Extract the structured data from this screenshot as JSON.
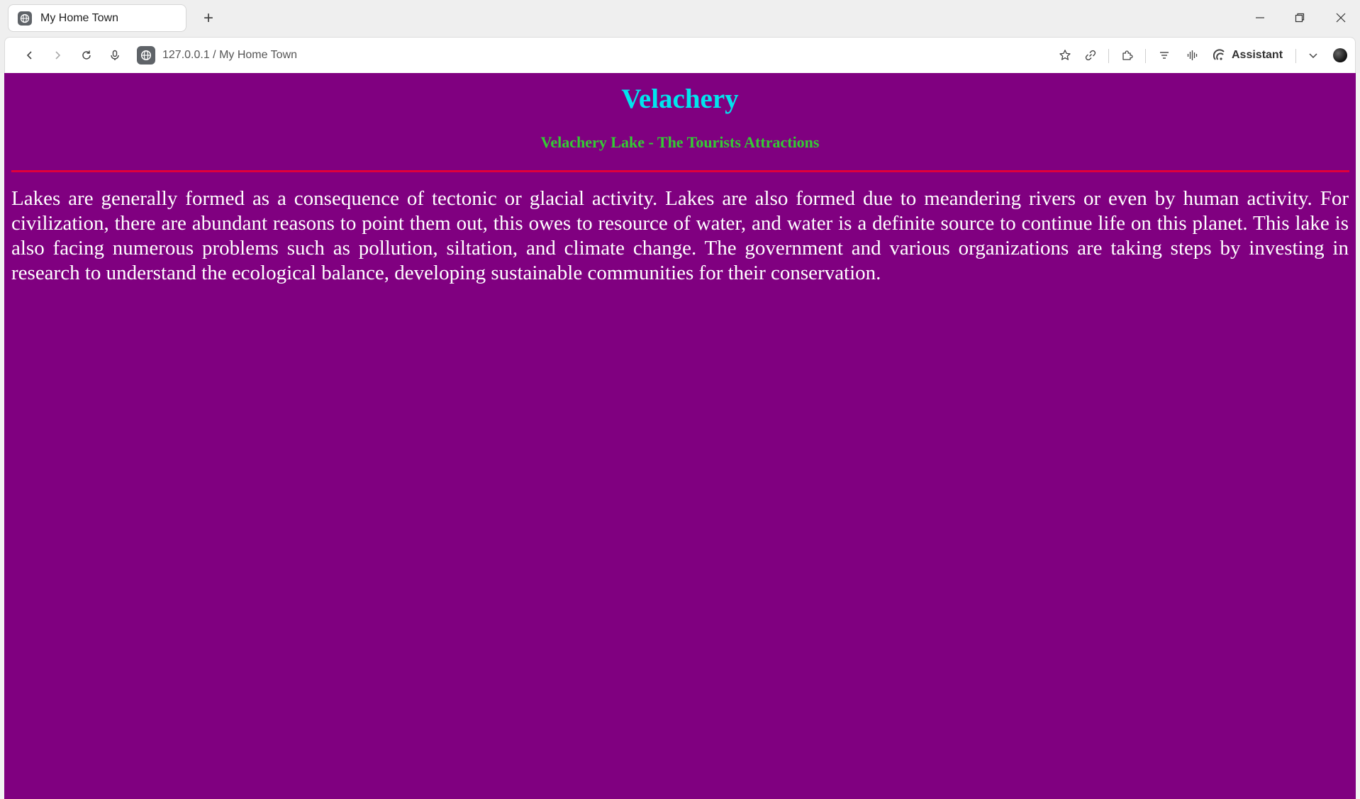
{
  "browser": {
    "tab_title": "My Home Town",
    "new_tab_symbol": "+",
    "url": "127.0.0.1 / My Home Town",
    "assistant_label": "Assistant",
    "icons": {
      "favicon": "globe-icon",
      "back": "back-arrow-icon",
      "forward": "forward-arrow-icon",
      "reload": "reload-icon",
      "mic": "microphone-icon",
      "bookmark": "star-icon",
      "link": "link-icon",
      "extensions": "puzzle-icon",
      "reader": "reader-mode-icon",
      "audio": "audio-wave-icon",
      "menu": "chevron-down-icon",
      "profile": "avatar"
    }
  },
  "page": {
    "background": "#800080",
    "heading": "Velachery",
    "subheading": "Velachery Lake - The Tourists Attractions",
    "rule_color": "#e0003b",
    "paragraph": "Lakes are generally formed as a consequence of tectonic or glacial activity. Lakes are also formed due to meandering rivers or even by human activity. For civilization, there are abundant reasons to point them out, this owes to resource of water, and water is a definite source to continue life on this planet. This lake is also facing numerous problems such as pollution, siltation, and climate change. The government and various organizations are taking steps by investing in research to understand the ecological balance, developing sustainable communities for their conservation."
  }
}
